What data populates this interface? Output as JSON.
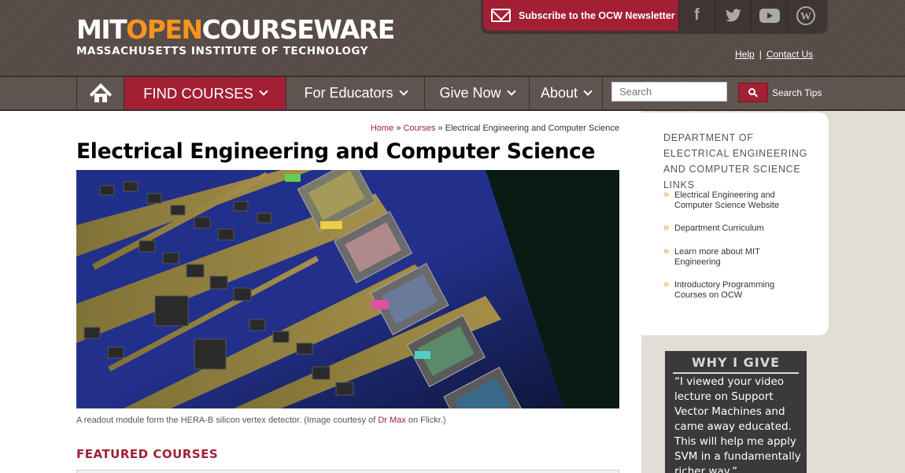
{
  "header": {
    "logo_mit": "MIT",
    "logo_open": "OPEN",
    "logo_courseware": "COURSEWARE",
    "logo_subtitle": "MASSACHUSETTS INSTITUTE OF TECHNOLOGY",
    "subscribe_label": "Subscribe to the OCW Newsletter",
    "social": [
      {
        "icon": "facebook-icon",
        "glyph": "f"
      },
      {
        "icon": "twitter-icon",
        "glyph": "❧"
      },
      {
        "icon": "youtube-icon",
        "glyph": "▶"
      },
      {
        "icon": "wordpress-icon",
        "glyph": "W"
      }
    ],
    "help_label": "Help",
    "help_sep": "|",
    "contact_label": "Contact Us"
  },
  "nav": {
    "find_courses": "FIND COURSES",
    "for_educators": "For Educators",
    "give_now": "Give Now",
    "about": "About",
    "search_placeholder": "Search",
    "search_tips": "Search Tips"
  },
  "main": {
    "breadcrumb": {
      "home": "Home",
      "sep1": "»",
      "courses": "Courses",
      "sep2": "»",
      "current": "Electrical Engineering and Computer Science"
    },
    "title": "Electrical Engineering and Computer Science",
    "caption_prefix": "A readout module form the HERA-B silicon vertex detector. (Image courtesy of ",
    "caption_link": "Dr Max",
    "caption_suffix": " on Flickr.)",
    "featured_heading": "FEATURED COURSES"
  },
  "sidebar": {
    "title": "DEPARTMENT OF ELECTRICAL ENGINEERING AND COMPUTER SCIENCE LINKS",
    "links": [
      "Electrical Engineering and Computer Science Website",
      "Department Curriculum",
      "Learn more about MIT Engineering",
      "Introductory Programming Courses on OCW"
    ]
  },
  "why_give": {
    "title": "WHY I GIVE",
    "quote": "“I viewed your video lecture on Support Vector Machines and came away educated. This will help me apply SVM in a fundamentally richer way.”"
  },
  "colors": {
    "accent": "#a31f34",
    "orange": "#f7941d",
    "header_bg": "#5a4f4b"
  }
}
